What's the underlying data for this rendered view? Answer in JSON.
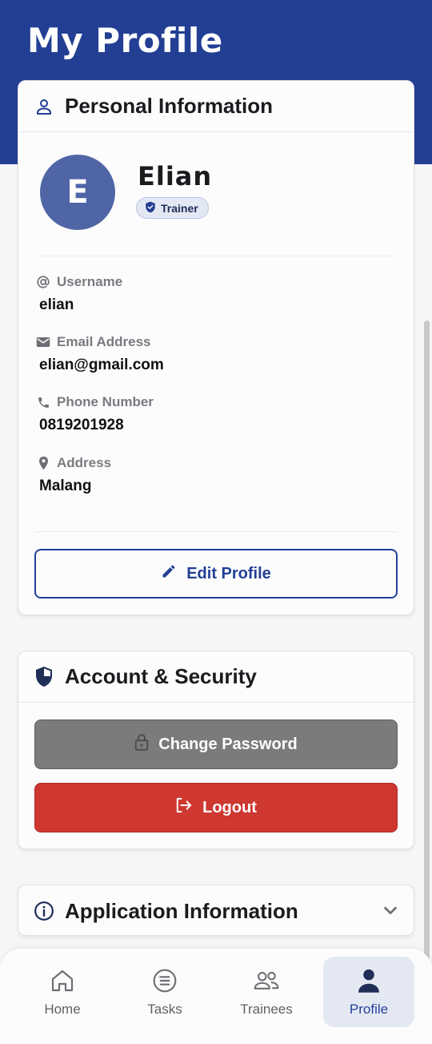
{
  "header": {
    "title": "My Profile"
  },
  "personal": {
    "title": "Personal Information",
    "avatar_initial": "E",
    "name": "Elian",
    "role": "Trainer",
    "fields": [
      {
        "label": "Username",
        "value": "elian",
        "icon": "at-icon"
      },
      {
        "label": "Email Address",
        "value": "elian@gmail.com",
        "icon": "email-icon"
      },
      {
        "label": "Phone Number",
        "value": "0819201928",
        "icon": "phone-icon"
      },
      {
        "label": "Address",
        "value": "Malang",
        "icon": "location-pin-icon"
      }
    ],
    "edit_label": "Edit Profile"
  },
  "security": {
    "title": "Account & Security",
    "change_password_label": "Change Password",
    "logout_label": "Logout"
  },
  "app_info": {
    "title": "Application Information"
  },
  "nav": {
    "items": [
      {
        "label": "Home",
        "icon": "home-icon"
      },
      {
        "label": "Tasks",
        "icon": "list-icon"
      },
      {
        "label": "Trainees",
        "icon": "people-icon"
      },
      {
        "label": "Profile",
        "icon": "person-icon",
        "active": true
      }
    ]
  },
  "colors": {
    "primary": "#233f94",
    "avatar": "#4f65a6",
    "danger": "#cf3731",
    "neutral_button": "#7b7b7b"
  }
}
